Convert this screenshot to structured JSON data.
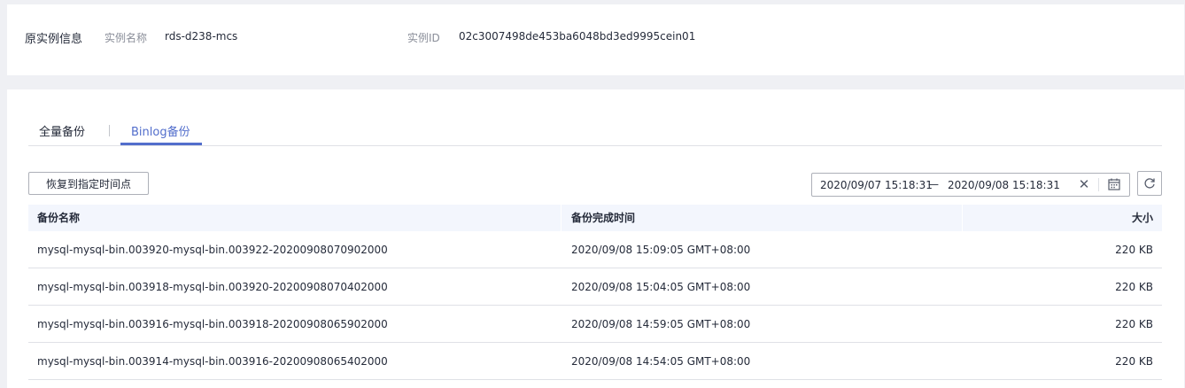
{
  "instance_info": {
    "title": "原实例信息",
    "name_label": "实例名称",
    "name_value": "rds-d238-mcs",
    "id_label": "实例ID",
    "id_value": "02c3007498de453ba6048bd3ed9995cein01"
  },
  "tabs": [
    {
      "label": "全量备份",
      "active": false
    },
    {
      "label": "Binlog备份",
      "active": true
    }
  ],
  "toolbar": {
    "restore_button_label": "恢复到指定时间点",
    "date_range": {
      "start": "2020/09/07 15:18:31",
      "separator": "—",
      "end": "2020/09/08 15:18:31"
    }
  },
  "table": {
    "columns": [
      "备份名称",
      "备份完成时间",
      "大小"
    ],
    "rows": [
      {
        "name": "mysql-mysql-bin.003920-mysql-bin.003922-20200908070902000",
        "time": "2020/09/08 15:09:05 GMT+08:00",
        "size": "220 KB"
      },
      {
        "name": "mysql-mysql-bin.003918-mysql-bin.003920-20200908070402000",
        "time": "2020/09/08 15:04:05 GMT+08:00",
        "size": "220 KB"
      },
      {
        "name": "mysql-mysql-bin.003916-mysql-bin.003918-20200908065902000",
        "time": "2020/09/08 14:59:05 GMT+08:00",
        "size": "220 KB"
      },
      {
        "name": "mysql-mysql-bin.003914-mysql-bin.003916-20200908065402000",
        "time": "2020/09/08 14:54:05 GMT+08:00",
        "size": "220 KB"
      }
    ]
  },
  "colors": {
    "accent": "#526ecc",
    "page_bg": "#eff0f4",
    "table_header_bg": "#f3f6fd",
    "border": "#dfe1e6"
  },
  "icons": [
    "close-icon",
    "calendar-icon",
    "refresh-icon"
  ]
}
